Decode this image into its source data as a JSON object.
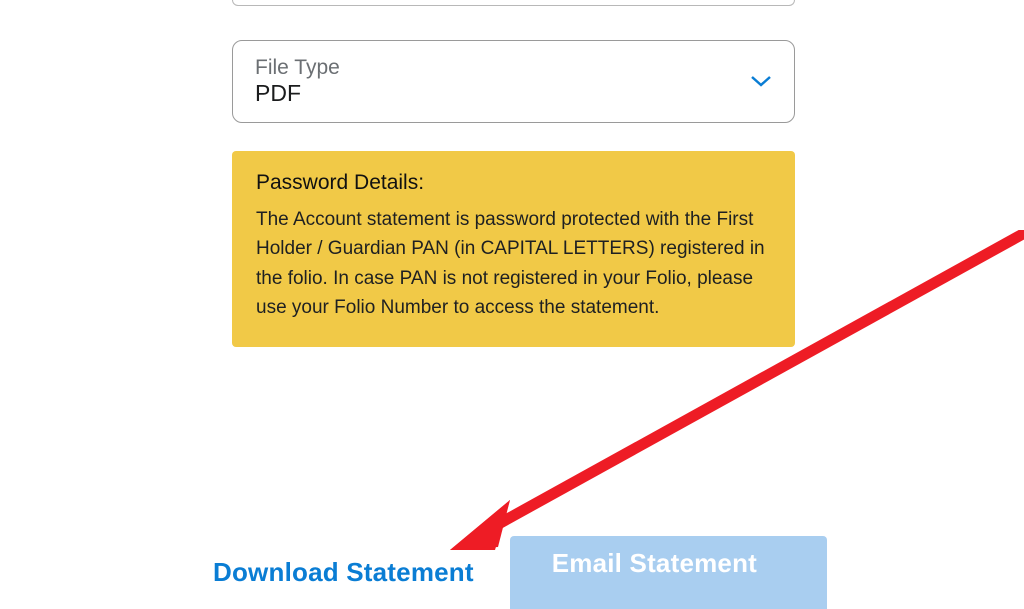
{
  "form": {
    "fileType": {
      "label": "File Type",
      "value": "PDF"
    }
  },
  "notice": {
    "title": "Password Details:",
    "body": "The Account statement is password protected with the First Holder / Guardian PAN (in CAPITAL LETTERS) registered in the folio. In case PAN is not registered in your Folio, please use your Folio Number to access the statement."
  },
  "actions": {
    "download": "Download Statement",
    "email": "Email Statement"
  },
  "colors": {
    "accent": "#0a7dd4",
    "notice_bg": "#f1c947",
    "button_bg": "#a9cef0",
    "annotation": "#ee1c25"
  }
}
